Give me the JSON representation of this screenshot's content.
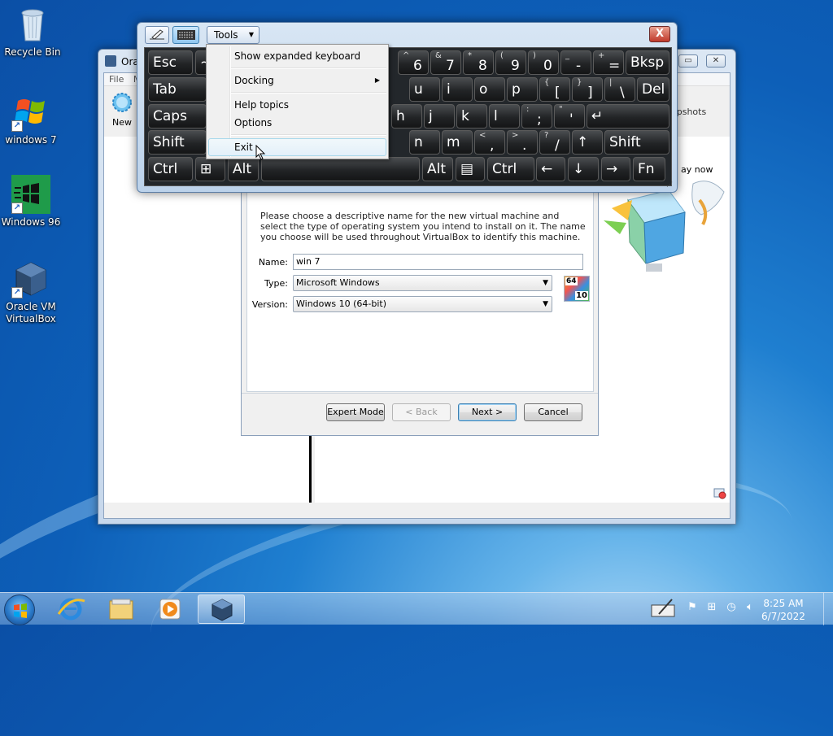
{
  "desktop": {
    "icons": [
      {
        "label": "Recycle Bin"
      },
      {
        "label": "windows 7"
      },
      {
        "label": "Windows 96"
      },
      {
        "label": "Oracle VM VirtualBox"
      }
    ]
  },
  "vbox_manager": {
    "title": "Ora",
    "menu": [
      "File",
      "M"
    ],
    "toolbar_new": "New",
    "snapshots_fragment": "apshots",
    "welcome_fragment": "ay now"
  },
  "osk": {
    "tools_label": "Tools",
    "close_glyph": "X",
    "rows": [
      [
        {
          "id": "esc",
          "label": "Esc"
        },
        {
          "id": "tilde",
          "label": "~"
        },
        {
          "id": "6",
          "small": "^",
          "big": "6"
        },
        {
          "id": "7",
          "small": "&",
          "big": "7"
        },
        {
          "id": "8",
          "small": "*",
          "big": "8"
        },
        {
          "id": "9",
          "small": "(",
          "big": "9"
        },
        {
          "id": "0",
          "small": ")",
          "big": "0"
        },
        {
          "id": "minus",
          "small": "_",
          "big": "-"
        },
        {
          "id": "equals",
          "small": "+",
          "big": "="
        },
        {
          "id": "bksp",
          "label": "Bksp"
        }
      ],
      [
        {
          "id": "tab",
          "label": "Tab"
        },
        {
          "id": "u",
          "label": "u"
        },
        {
          "id": "i",
          "label": "i"
        },
        {
          "id": "o",
          "label": "o"
        },
        {
          "id": "p",
          "label": "p"
        },
        {
          "id": "lbracket",
          "small": "{",
          "big": "["
        },
        {
          "id": "rbracket",
          "small": "}",
          "big": "]"
        },
        {
          "id": "backslash",
          "small": "|",
          "big": "\\"
        },
        {
          "id": "del",
          "label": "Del"
        }
      ],
      [
        {
          "id": "caps",
          "label": "Caps"
        },
        {
          "id": "h",
          "label": "h"
        },
        {
          "id": "j",
          "label": "j"
        },
        {
          "id": "k",
          "label": "k"
        },
        {
          "id": "l",
          "label": "l"
        },
        {
          "id": "semicolon",
          "small": ":",
          "big": ";"
        },
        {
          "id": "quote",
          "small": "\"",
          "big": "'"
        },
        {
          "id": "enter",
          "label": "↵"
        }
      ],
      [
        {
          "id": "shift_l",
          "label": "Shift"
        },
        {
          "id": "n",
          "label": "n"
        },
        {
          "id": "m",
          "label": "m"
        },
        {
          "id": "comma",
          "small": "<",
          "big": ","
        },
        {
          "id": "period",
          "small": ">",
          "big": "."
        },
        {
          "id": "slash",
          "small": "?",
          "big": "/"
        },
        {
          "id": "up",
          "label": "↑"
        },
        {
          "id": "shift_r",
          "label": "Shift"
        }
      ],
      [
        {
          "id": "ctrl_l",
          "label": "Ctrl"
        },
        {
          "id": "win",
          "label": "⊞"
        },
        {
          "id": "alt_l",
          "label": "Alt"
        },
        {
          "id": "space",
          "label": ""
        },
        {
          "id": "alt_r",
          "label": "Alt"
        },
        {
          "id": "menu",
          "label": "▤"
        },
        {
          "id": "ctrl_r",
          "label": "Ctrl"
        },
        {
          "id": "left",
          "label": "←"
        },
        {
          "id": "down",
          "label": "↓"
        },
        {
          "id": "right",
          "label": "→"
        },
        {
          "id": "fn",
          "label": "Fn"
        }
      ]
    ]
  },
  "tools_menu": {
    "items": [
      "Show expanded keyboard",
      "Docking",
      "Help topics",
      "Options",
      "Exit"
    ],
    "hovered": "Exit"
  },
  "wizard": {
    "description": "Please choose a descriptive name for the new virtual machine and select the type of operating system you intend to install on it. The name you choose will be used throughout VirtualBox to identify this machine.",
    "name_label": "Name:",
    "name_value": "win 7",
    "type_label": "Type:",
    "type_value": "Microsoft Windows",
    "version_label": "Version:",
    "version_value": "Windows 10 (64-bit)",
    "os_badge_top": "64",
    "os_badge_bottom": "10",
    "buttons": {
      "expert": "Expert Mode",
      "back": "< Back",
      "next": "Next >",
      "cancel": "Cancel"
    }
  },
  "taskbar": {
    "time": "8:25 AM",
    "date": "6/7/2022"
  }
}
